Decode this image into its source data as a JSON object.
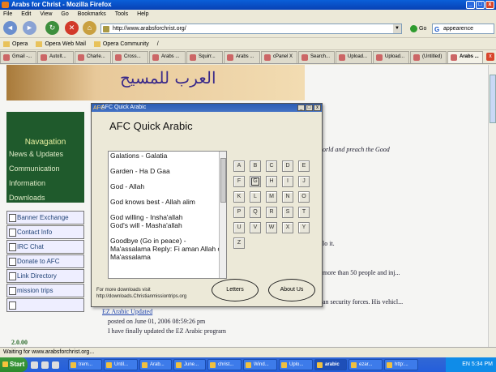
{
  "window": {
    "title": "Arabs for Christ - Mozilla Firefox",
    "min": "_",
    "max": "□",
    "close": "x"
  },
  "menu": [
    "File",
    "Edit",
    "View",
    "Go",
    "Bookmarks",
    "Tools",
    "Help"
  ],
  "nav": {
    "url": "http://www.arabsforchrist.org/",
    "go_label": "Go",
    "search_value": "appearence",
    "search_glyph": "G",
    "back": "◄",
    "forward": "►",
    "reload": "↻",
    "stop": "✕",
    "home": "⌂"
  },
  "bookmarks": [
    "Opera",
    "Opera Web Mail",
    "Opera Community",
    "/"
  ],
  "tabs": [
    "Gmail -...",
    "AutoIt...",
    "Charle...",
    "Cross...",
    "Arabs ...",
    "Squirr...",
    "Arabs ...",
    "cPanel X",
    "Search...",
    "Upload...",
    "Upload...",
    "(Untitled)",
    "Arabs ..."
  ],
  "page": {
    "banner_text": "العرب للمسيح",
    "sidebar": {
      "heading": "Navagation",
      "items": [
        "News & Updates",
        "Communication",
        "Information",
        "Downloads"
      ]
    },
    "links": [
      "Banner Exchange",
      "Contact Info",
      "IRC Chat",
      "Donate to AFC",
      "Link Directory",
      "mission trips",
      ""
    ],
    "right_line1": "orld and preach the Good",
    "right_line2": "lo it.",
    "right_line3": "more than 50 people and inj...",
    "right_line4": "an security forces. His vehicl...",
    "article_title": "EZ Arabic Updated",
    "article_date": "posted on June 01, 2006 08:59:26 pm",
    "article_body": "I have finally updated the EZ Arabic program",
    "logo_text": "2.0.00"
  },
  "dialog": {
    "title": "AFC Quick Arabic",
    "icon": "AFC",
    "heading": "AFC Quick Arabic",
    "items": [
      "Galations - Galatia",
      "Garden - Ha D Gaa",
      "God - Allah",
      "God knows best - Allah alim",
      "God willing - Insha'allah\nGod's will - Masha'allah",
      "Goodbye (Go in peace) - Ma'assalama  Reply: Fi aman Allah or Ma'assalama"
    ],
    "letters": [
      "A",
      "B",
      "C",
      "D",
      "E",
      "F",
      "G",
      "H",
      "I",
      "J",
      "K",
      "L",
      "M",
      "N",
      "O",
      "P",
      "Q",
      "R",
      "S",
      "T",
      "U",
      "V",
      "W",
      "X",
      "Y",
      "Z"
    ],
    "selected_letter": "G",
    "footer": "For more downloads visit\nhttp://downloads.Christianmissiontrips.org",
    "btn_letters": "Letters",
    "btn_about": "About Us",
    "ctl_min": "_",
    "ctl_max": "□",
    "ctl_close": "x"
  },
  "status": "Waiting for www.arabsforchrist.org...",
  "taskbar": {
    "start": "Start",
    "buttons": [
      "trem...",
      "Until...",
      "Arab...",
      "June...",
      "christ...",
      "Wind...",
      "Uplo...",
      "arabic",
      "ezar...",
      "http:..."
    ],
    "active_index": 7,
    "lang": "EN",
    "time": "5:34 PM"
  }
}
